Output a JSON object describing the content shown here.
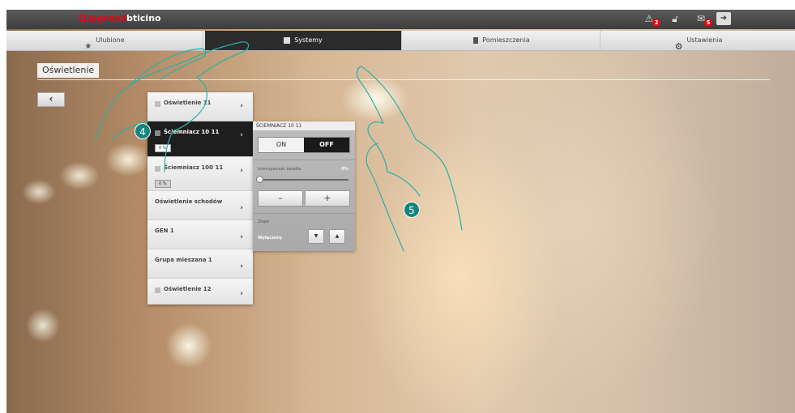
{
  "brand": {
    "legrand": "legrand",
    "bticino": "bticino"
  },
  "topbar": {
    "alerts_count": "2",
    "messages_count": "5"
  },
  "nav": {
    "tabs": [
      {
        "label": "Ulubione",
        "icon": "star-icon"
      },
      {
        "label": "Systemy",
        "icon": "square-icon",
        "active": true
      },
      {
        "label": "Pomieszczenia",
        "icon": "door-icon"
      },
      {
        "label": "Ustawienia",
        "icon": "gear-icon"
      }
    ]
  },
  "page": {
    "title": "Oświetlenie",
    "back": "‹"
  },
  "list": {
    "items": [
      {
        "label": "Oświetlenie 11",
        "has_bulb": true
      },
      {
        "label": "Ściemniacz 10 11",
        "has_bulb": true,
        "percent": "0 %",
        "selected": true
      },
      {
        "label": "Ściemniacz 100 11",
        "has_bulb": true,
        "percent": "0 %"
      },
      {
        "label": "Oświetlenie schodów",
        "has_bulb": false
      },
      {
        "label": "GEN 1",
        "has_bulb": false
      },
      {
        "label": "Grupa mieszana 1",
        "has_bulb": false
      },
      {
        "label": "Oświetlenie 12",
        "has_bulb": true
      }
    ]
  },
  "panel": {
    "title": "ŚCIEMNIACZ 10 11",
    "on_label": "ON",
    "off_label": "OFF",
    "intensity_label": "Intensywność światła",
    "intensity_value": "0%",
    "minus": "–",
    "plus": "+",
    "clock_label": "Zegar",
    "clock_value": "Wyłączony",
    "down": "▼",
    "up": "▲"
  },
  "callouts": {
    "step4": "4",
    "step5": "5"
  },
  "colors": {
    "accent_red": "#e30613",
    "callout_teal": "#16857f",
    "active_tab": "#2b2b2b"
  }
}
